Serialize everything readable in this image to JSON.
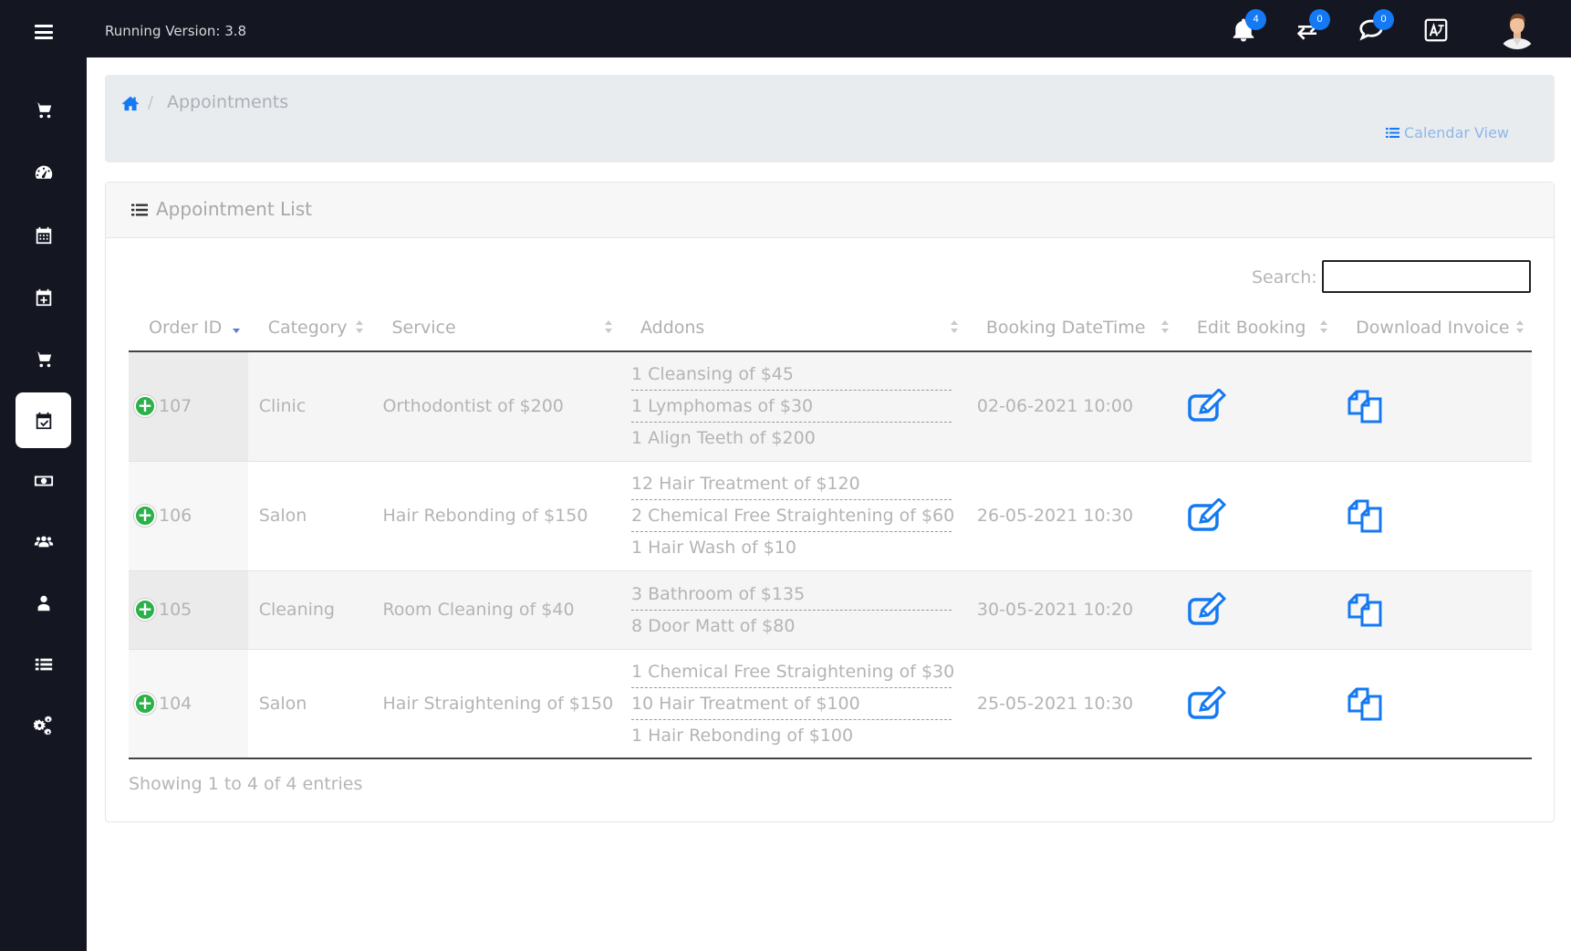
{
  "topbar": {
    "version_text": "Running Version: 3.8",
    "notifications_badge": "4",
    "transfers_badge": "0",
    "messages_badge": "0"
  },
  "sidebar": {
    "items": [
      "shopping-cart-icon",
      "dashboard-icon",
      "calendar-icon",
      "calendar-plus-icon",
      "cart-icon",
      "calendar-check-icon",
      "money-icon",
      "users-icon",
      "user-icon",
      "list-icon",
      "cogs-icon"
    ],
    "active_index": 5
  },
  "breadcrumb": {
    "separator": "/",
    "current": "Appointments",
    "calendar_view_label": "Calendar View"
  },
  "card": {
    "title": "Appointment List",
    "search_label": "Search:",
    "search_value": "",
    "columns": [
      "Order ID",
      "Category",
      "Service",
      "Addons",
      "Booking DateTime",
      "Edit Booking",
      "Download Invoice"
    ],
    "rows": [
      {
        "order_id": "107",
        "category": "Clinic",
        "service": "Orthodontist of $200",
        "addons": [
          "1 Cleansing of $45",
          "1 Lymphomas of $30",
          "1 Align Teeth of $200"
        ],
        "datetime": "02-06-2021 10:00"
      },
      {
        "order_id": "106",
        "category": "Salon",
        "service": "Hair Rebonding of $150",
        "addons": [
          "12 Hair Treatment of $120",
          "2 Chemical Free Straightening of $60",
          "1 Hair Wash of $10"
        ],
        "datetime": "26-05-2021 10:30"
      },
      {
        "order_id": "105",
        "category": "Cleaning",
        "service": "Room Cleaning of $40",
        "addons": [
          "3 Bathroom of $135",
          "8 Door Matt of $80"
        ],
        "datetime": "30-05-2021 10:20"
      },
      {
        "order_id": "104",
        "category": "Salon",
        "service": "Hair Straightening of $150",
        "addons": [
          "1 Chemical Free Straightening of $30",
          "10 Hair Treatment of $100",
          "1 Hair Rebonding of $100"
        ],
        "datetime": "25-05-2021 10:30"
      }
    ],
    "showing_text": "Showing 1 to 4 of 4 entries"
  },
  "colors": {
    "topbar_bg": "#141622",
    "accent_blue": "#1479f2",
    "plus_green": "#2bb04a"
  }
}
